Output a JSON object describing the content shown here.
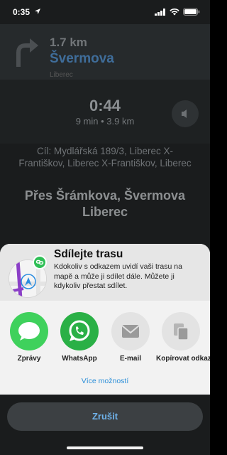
{
  "status_bar": {
    "time": "0:35"
  },
  "navigation": {
    "distance": "1.7 km",
    "street": "Švermova",
    "city": "Liberec",
    "eta_time": "0:44",
    "eta_details": "9 min • 3.9 km",
    "destination": "Cíl: Mydlářská 189/3, Liberec X-Františkov, Liberec X-Františkov, Liberec",
    "via": "Přes Šrámkova, Švermova Liberec"
  },
  "share_sheet": {
    "title": "Sdílejte trasu",
    "description": "Kdokoliv s odkazem uvidí vaši trasu na mapě a může ji sdílet dále. Můžete ji kdykoliv přestat sdílet.",
    "apps": [
      {
        "label": "Zprávy"
      },
      {
        "label": "WhatsApp"
      },
      {
        "label": "E-mail"
      },
      {
        "label": "Kopírovat odkaz"
      }
    ],
    "more_label": "Více možností",
    "cancel_label": "Zrušit"
  },
  "colors": {
    "messages_green": "#3fd15c",
    "whatsapp_green": "#2ab046",
    "accent_blue": "#2a8ed8"
  }
}
